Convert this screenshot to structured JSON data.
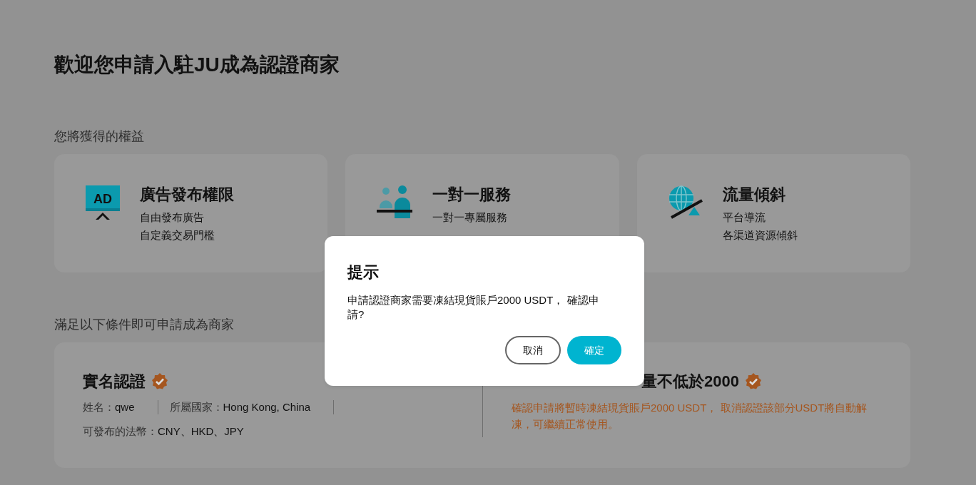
{
  "page_title": "歡迎您申請入駐JU成為認證商家",
  "benefits": {
    "heading": "您將獲得的權益",
    "items": [
      {
        "kind": "billboard",
        "icon_text": "AD",
        "title": "廣告發布權限",
        "lines": [
          "自由發布廣告",
          "自定義交易門檻"
        ]
      },
      {
        "kind": "people",
        "title": "一對一服務",
        "lines": [
          "一對一專屬服務"
        ]
      },
      {
        "kind": "globe",
        "title": "流量傾斜",
        "lines": [
          "平台導流",
          "各渠道資源傾斜"
        ]
      }
    ]
  },
  "requirements": {
    "heading": "滿足以下條件即可申請成為商家",
    "items": [
      {
        "kind": "info",
        "title": "實名認證",
        "verified": true,
        "rows": [
          {
            "separated": true,
            "fields": [
              {
                "label": "姓名：",
                "value": "qwe"
              },
              {
                "label": "所屬國家：",
                "value": "Hong Kong, China"
              }
            ]
          },
          {
            "separated": false,
            "fields": [
              {
                "label": "可發布的法幣：",
                "value": "CNY、HKD、JPY"
              }
            ]
          }
        ]
      },
      {
        "kind": "notice",
        "title": "量不低於2000",
        "verified": true,
        "note": "確認申請將暫時凍結現貨賬戶2000 USDT， 取消認證該部分USDT將自動解凍，可繼續正常使用。"
      }
    ]
  },
  "dialog": {
    "title": "提示",
    "message": "申請認證商家需要凍結現貨賬戶2000 USDT， 確認申請?",
    "buttons": [
      {
        "label": "取消",
        "kind": "secondary"
      },
      {
        "label": "確定",
        "kind": "primary"
      }
    ]
  }
}
